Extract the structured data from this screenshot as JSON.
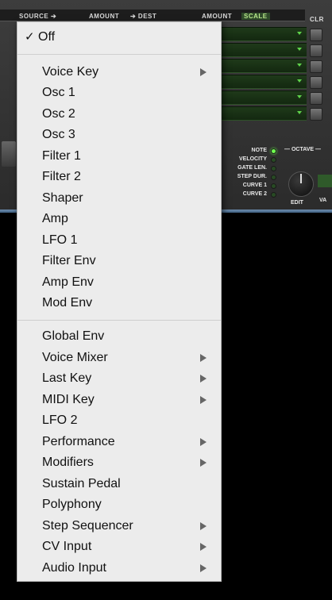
{
  "panel": {
    "header": {
      "source": "SOURCE ➔",
      "amount1": "AMOUNT",
      "dest": "➔ DEST",
      "amount2": "AMOUNT",
      "scale": "SCALE",
      "clr": "CLR"
    },
    "destinations": {
      "labels": [
        "NOTE",
        "VELOCITY",
        "GATE LEN.",
        "STEP DUR.",
        "CURVE 1",
        "CURVE 2"
      ],
      "selected": "NOTE",
      "octave": "— OCTAVE —",
      "edit": "EDIT",
      "va": "VA"
    },
    "accent_color": "#6fff4e"
  },
  "menu": {
    "check_glyph": "✓",
    "selected": "Off",
    "items": [
      {
        "label": "Off",
        "checked": true,
        "submenu": false
      },
      {
        "label": "Voice Key",
        "submenu": true
      },
      {
        "label": "Osc 1",
        "submenu": false
      },
      {
        "label": "Osc 2",
        "submenu": false
      },
      {
        "label": "Osc 3",
        "submenu": false
      },
      {
        "label": "Filter 1",
        "submenu": false
      },
      {
        "label": "Filter 2",
        "submenu": false
      },
      {
        "label": "Shaper",
        "submenu": false
      },
      {
        "label": "Amp",
        "submenu": false
      },
      {
        "label": "LFO 1",
        "submenu": false
      },
      {
        "label": "Filter Env",
        "submenu": false
      },
      {
        "label": "Amp Env",
        "submenu": false
      },
      {
        "label": "Mod Env",
        "submenu": false
      },
      {
        "label": "Global Env",
        "submenu": false
      },
      {
        "label": "Voice Mixer",
        "submenu": true
      },
      {
        "label": "Last Key",
        "submenu": true
      },
      {
        "label": "MIDI Key",
        "submenu": true
      },
      {
        "label": "LFO 2",
        "submenu": false
      },
      {
        "label": "Performance",
        "submenu": true
      },
      {
        "label": "Modifiers",
        "submenu": true
      },
      {
        "label": "Sustain Pedal",
        "submenu": false
      },
      {
        "label": "Polyphony",
        "submenu": false
      },
      {
        "label": "Step Sequencer",
        "submenu": true
      },
      {
        "label": "CV Input",
        "submenu": true
      },
      {
        "label": "Audio Input",
        "submenu": true
      }
    ]
  }
}
